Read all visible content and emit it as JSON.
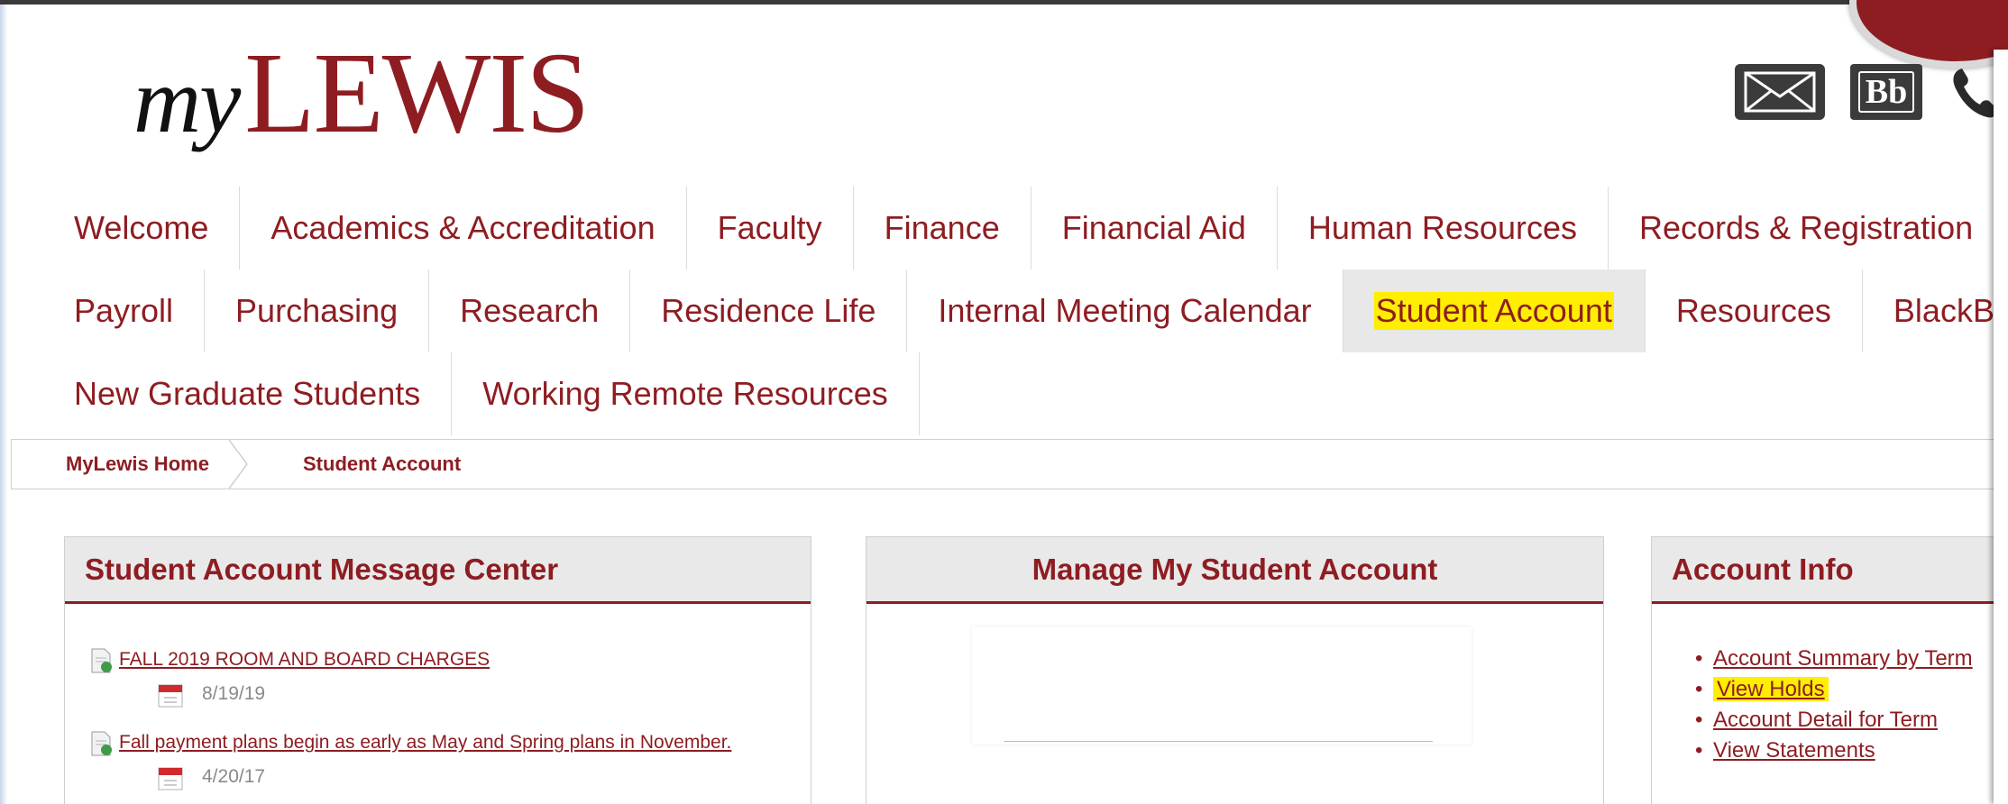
{
  "brand": {
    "logo_my": "my",
    "logo_name": "LEWIS",
    "accent": "#8e1d22",
    "highlight": "#ffee00"
  },
  "header_icons": [
    "mail-icon",
    "blackboard-icon",
    "phone-icon"
  ],
  "blackboard_label": "Bb",
  "nav": {
    "rows": [
      [
        "Welcome",
        "Academics & Accreditation",
        "Faculty",
        "Finance",
        "Financial Aid",
        "Human Resources",
        "Records & Registration"
      ],
      [
        "Payroll",
        "Purchasing",
        "Research",
        "Residence Life",
        "Internal Meeting Calendar",
        "Student Account",
        "Resources",
        "BlackBoar"
      ],
      [
        "New Graduate Students",
        "Working Remote Resources"
      ]
    ],
    "active": "Student Account"
  },
  "breadcrumb": {
    "home": "MyLewis Home",
    "current": "Student Account"
  },
  "message_center": {
    "title": "Student Account Message Center",
    "messages": [
      {
        "title": "FALL 2019 ROOM AND BOARD CHARGES",
        "date": "8/19/19"
      },
      {
        "title": "Fall payment plans begin as early as May and Spring plans in November.",
        "date": "4/20/17"
      }
    ]
  },
  "manage": {
    "title": "Manage My Student Account"
  },
  "account_info": {
    "title": "Account Info",
    "links": [
      "Account Summary by Term",
      "View Holds",
      "Account Detail for Term",
      "View Statements"
    ],
    "highlighted": "View Holds"
  }
}
